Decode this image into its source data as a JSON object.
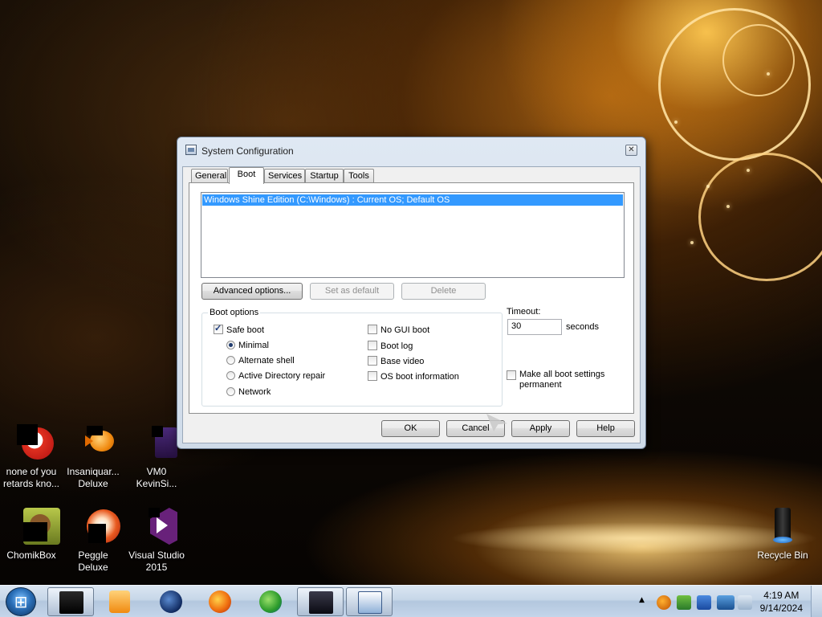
{
  "dialog": {
    "title": "System Configuration",
    "close_glyph": "✕",
    "tabs": [
      {
        "label": "General",
        "active": false
      },
      {
        "label": "Boot",
        "active": true
      },
      {
        "label": "Services",
        "active": false
      },
      {
        "label": "Startup",
        "active": false
      },
      {
        "label": "Tools",
        "active": false
      }
    ],
    "os_entries": [
      "Windows Shine Edition (C:\\Windows) : Current OS; Default OS"
    ],
    "buttons": {
      "advanced": "Advanced options...",
      "set_default": "Set as default",
      "delete": "Delete",
      "ok": "OK",
      "cancel": "Cancel",
      "apply": "Apply",
      "help": "Help"
    },
    "boot_options": {
      "group_title": "Boot options",
      "safe_boot": {
        "label": "Safe boot",
        "checked": true
      },
      "safe_boot_modes": [
        {
          "label": "Minimal",
          "selected": true
        },
        {
          "label": "Alternate shell",
          "selected": false
        },
        {
          "label": "Active Directory repair",
          "selected": false
        },
        {
          "label": "Network",
          "selected": false
        }
      ],
      "flags": [
        {
          "label": "No GUI boot",
          "checked": false
        },
        {
          "label": "Boot log",
          "checked": false
        },
        {
          "label": "Base video",
          "checked": false
        },
        {
          "label": "OS boot information",
          "checked": false
        }
      ]
    },
    "timeout": {
      "label": "Timeout:",
      "value": "30",
      "unit": "seconds"
    },
    "make_permanent": {
      "label": "Make all boot settings\npermanent",
      "checked": false
    }
  },
  "desktop_icons": [
    {
      "label": "none of you\nretards kno...",
      "icon": "red-swirl-icon"
    },
    {
      "label": "Insaniquar...\nDeluxe",
      "icon": "goldfish-icon"
    },
    {
      "label": "VM0\nKevinSi...",
      "icon": "vm-icon"
    },
    {
      "label": "ChomikBox",
      "icon": "hamster-icon"
    },
    {
      "label": "Peggle Deluxe",
      "icon": "peggle-icon"
    },
    {
      "label": "Visual Studio\n2015",
      "icon": "visual-studio-icon"
    },
    {
      "label": "Recycle Bin",
      "icon": "recycle-bin-icon"
    }
  ],
  "taskbar": {
    "items": [
      {
        "name": "taskbar-app-1",
        "icon": "black-box-icon",
        "active": true
      },
      {
        "name": "taskbar-media-player",
        "icon": "media-player-icon",
        "active": false
      },
      {
        "name": "taskbar-globe",
        "icon": "globe-icon",
        "active": false
      },
      {
        "name": "taskbar-firefox",
        "icon": "firefox-icon",
        "active": false
      },
      {
        "name": "taskbar-download-manager",
        "icon": "download-manager-icon",
        "active": false
      },
      {
        "name": "taskbar-app-screen",
        "icon": "monitor-icon",
        "active": true
      },
      {
        "name": "taskbar-msconfig",
        "icon": "msconfig-icon",
        "active": true
      }
    ],
    "tray_arrow": "▲",
    "clock_time": "4:19 AM",
    "clock_date": "9/14/2024"
  },
  "colors": {
    "selection": "#3399ff",
    "taskbar": "#c6d6e8",
    "dialog_frame": "#cfdbe9"
  }
}
